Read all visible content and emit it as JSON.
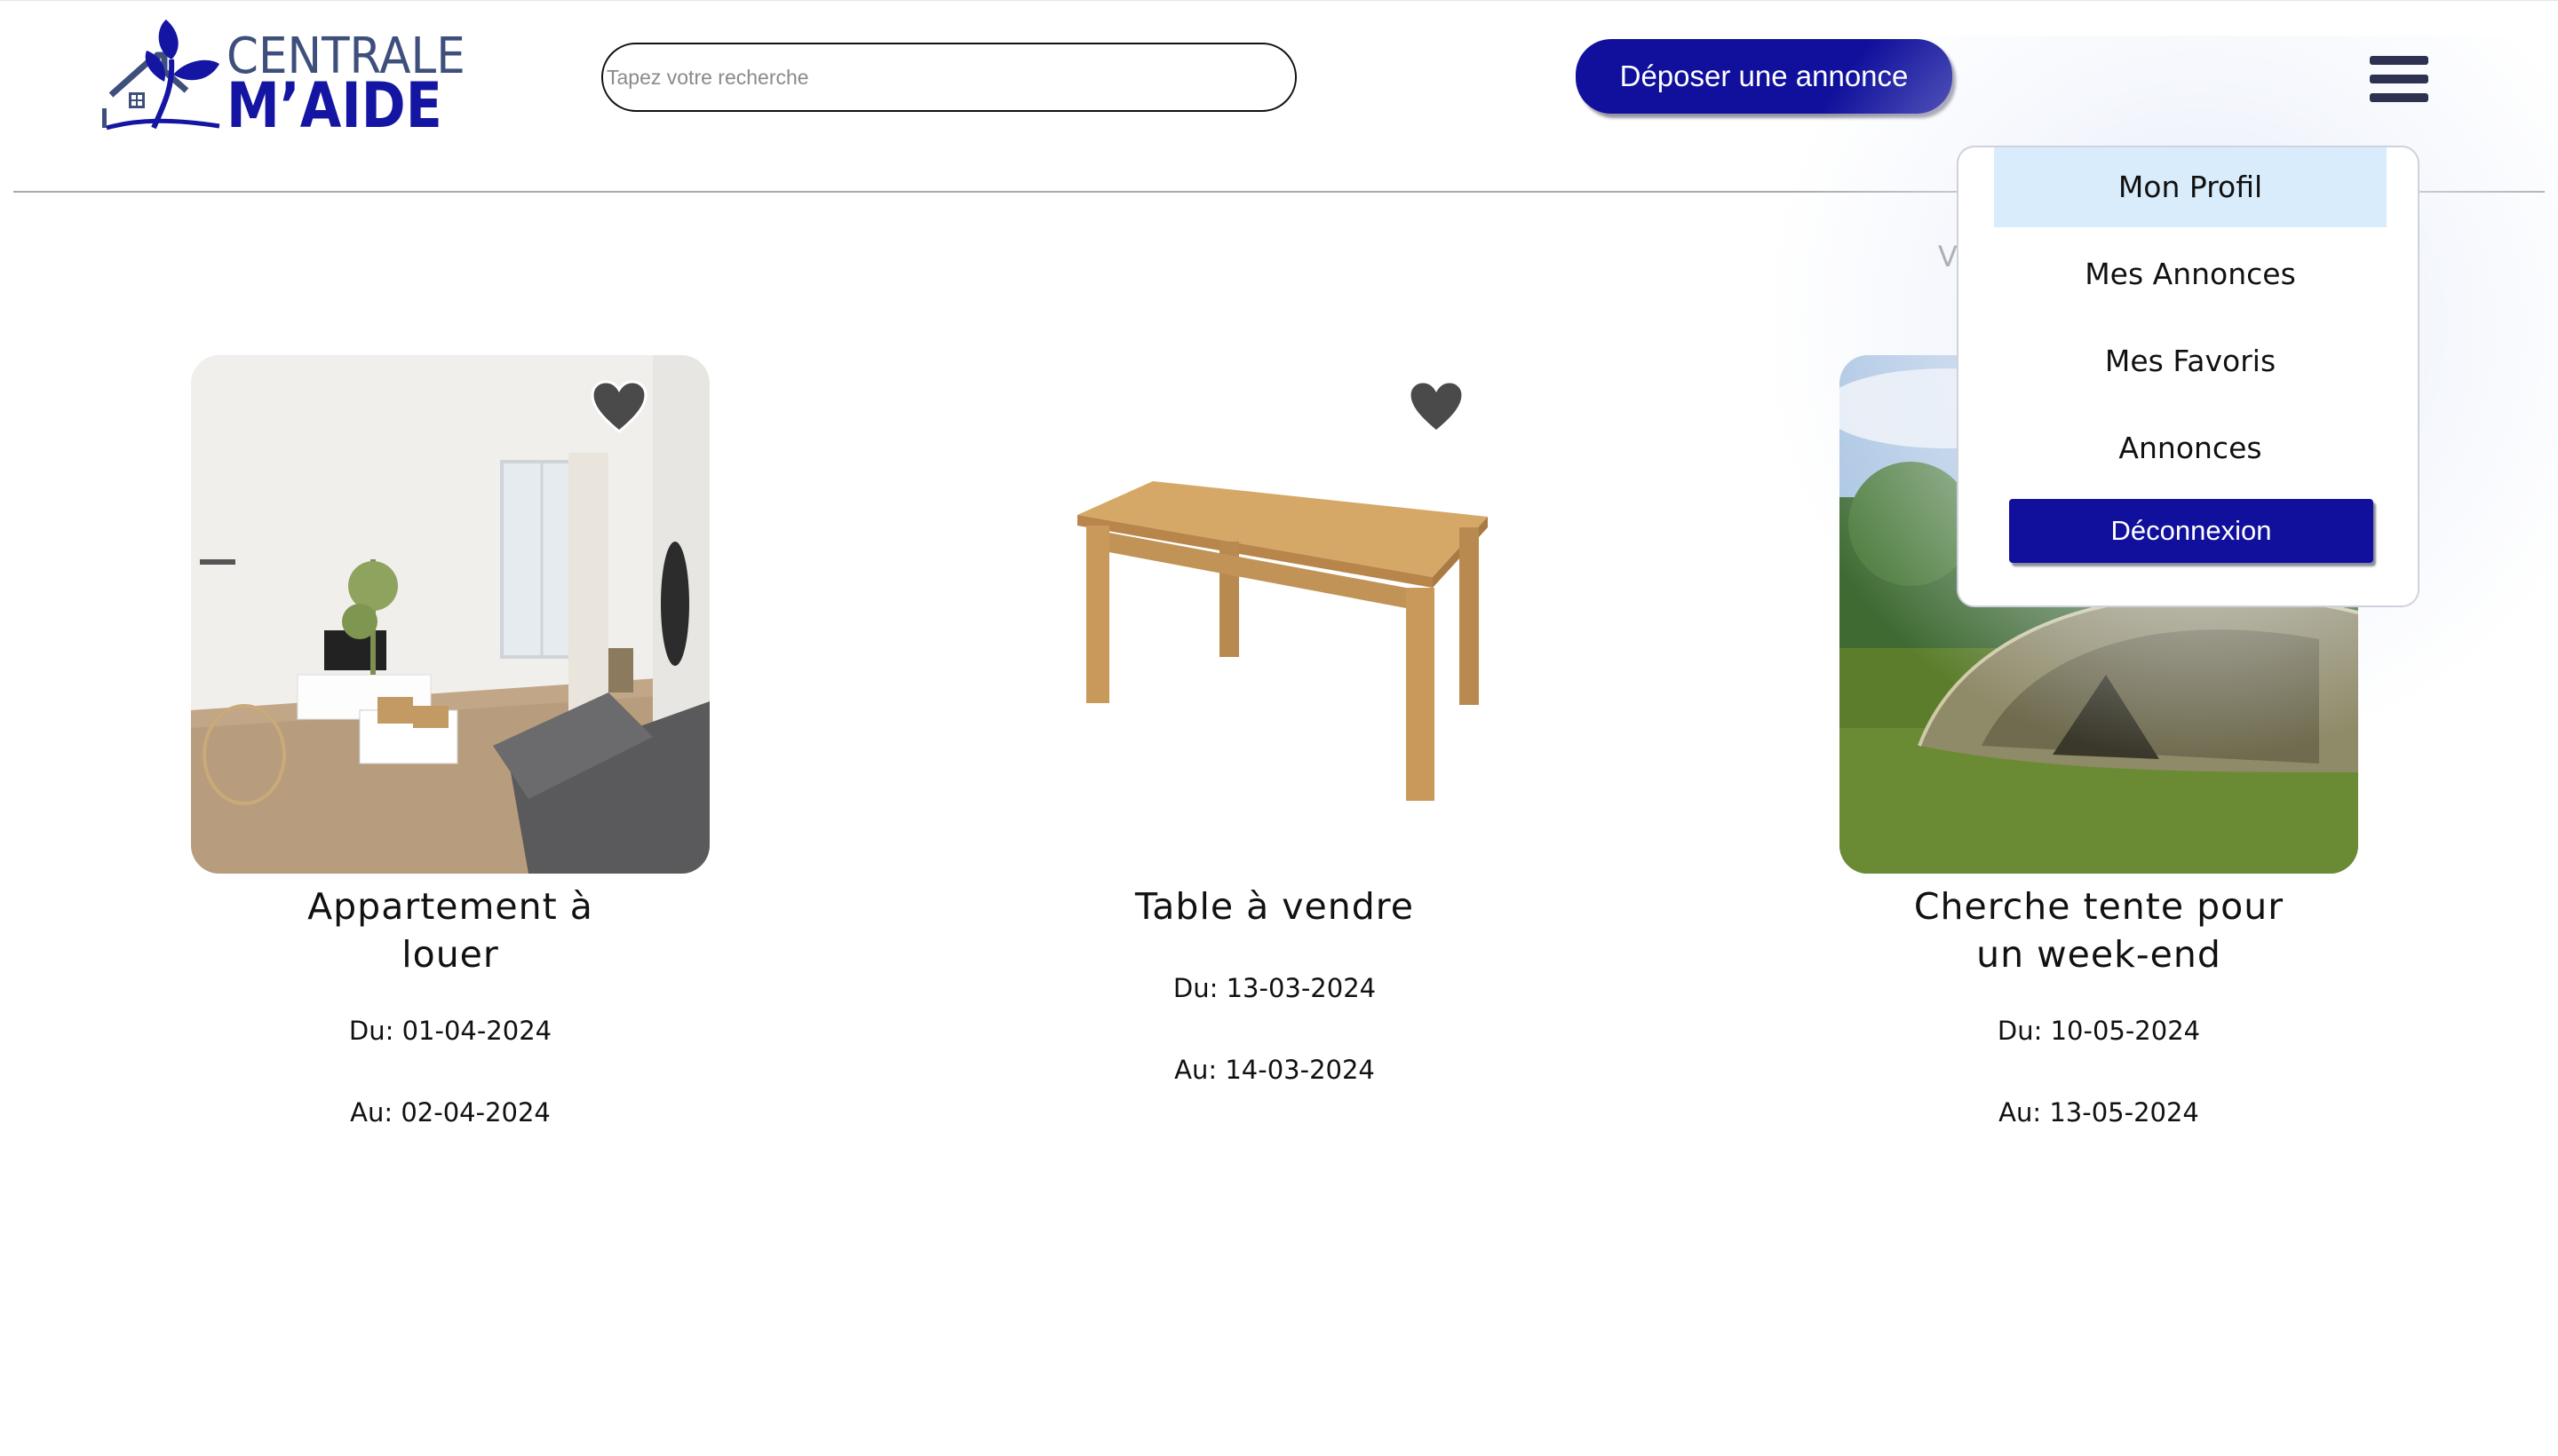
{
  "header": {
    "logo_line1": "CENTRALE",
    "logo_line2": "M’AIDE",
    "search_placeholder": "Tapez votre recherche",
    "post_button": "Déposer une annonce",
    "menu_icon": "hamburger-icon"
  },
  "background_partial_text": "V",
  "listings": [
    {
      "title": "Appartement à louer",
      "from": "Du: 01-04-2024",
      "to": "Au: 02-04-2024",
      "favorite_icon": "heart-icon"
    },
    {
      "title": "Table à vendre",
      "from": "Du: 13-03-2024",
      "to": "Au: 14-03-2024",
      "favorite_icon": "heart-icon"
    },
    {
      "title": "Cherche tente pour un week-end",
      "from": "Du: 10-05-2024",
      "to": "Au: 13-05-2024",
      "favorite_icon": "heart-icon"
    }
  ],
  "menu": {
    "items": [
      "Mon Profil",
      "Mes Annonces",
      "Mes Favoris",
      "Annonces"
    ],
    "active": "Mon Profil",
    "logout": "Déconnexion"
  },
  "colors": {
    "brand_blue": "#10109c",
    "logo_gray": "#3f4f7c",
    "heart": "#4a4a4a",
    "active_menu_bg": "#d9ecfb"
  }
}
